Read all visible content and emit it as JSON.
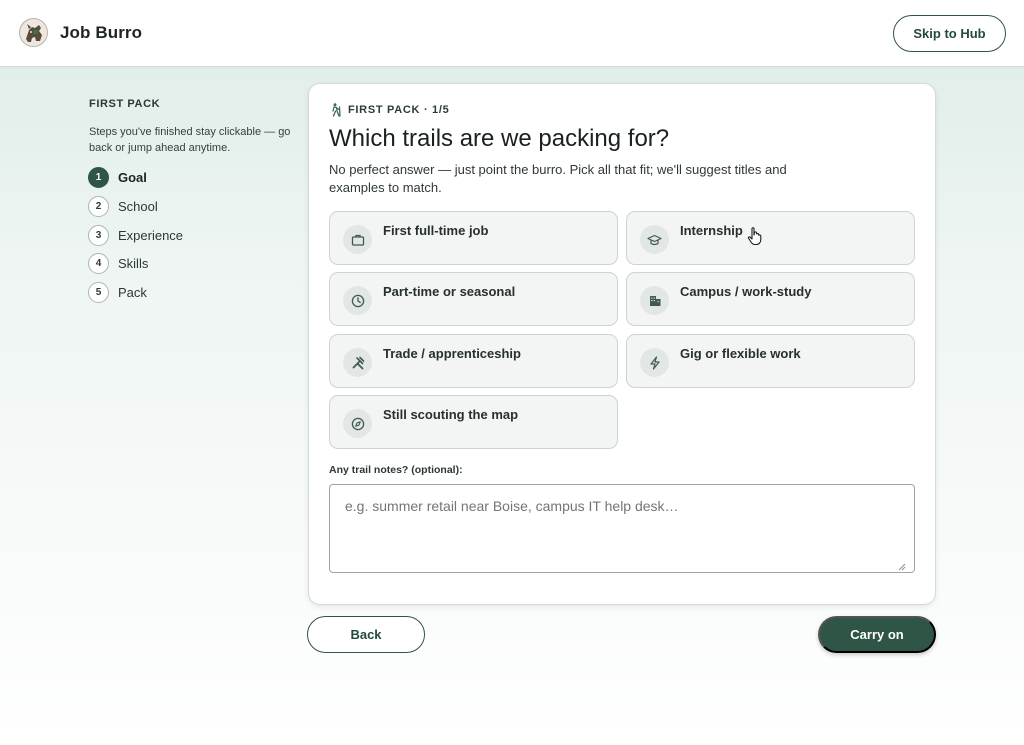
{
  "header": {
    "brand": "Job Burro",
    "skip_label": "Skip to Hub"
  },
  "sidebar": {
    "title": "FIRST PACK",
    "help": "Steps you've finished stay clickable — go back or jump ahead anytime.",
    "steps": [
      {
        "num": "1",
        "label": "Goal",
        "active": true
      },
      {
        "num": "2",
        "label": "School"
      },
      {
        "num": "3",
        "label": "Experience"
      },
      {
        "num": "4",
        "label": "Skills"
      },
      {
        "num": "5",
        "label": "Pack"
      }
    ]
  },
  "card": {
    "eyebrow": "FIRST PACK · 1/5",
    "title": "Which trails are we packing for?",
    "subtitle": "No perfect answer — just point the burro. Pick all that fit; we'll suggest titles and examples to match.",
    "options": [
      {
        "label": "First full-time job",
        "icon": "briefcase-icon"
      },
      {
        "label": "Internship",
        "icon": "graduation-cap-icon"
      },
      {
        "label": "Part-time or seasonal",
        "icon": "clock-icon"
      },
      {
        "label": "Campus / work-study",
        "icon": "building-icon"
      },
      {
        "label": "Trade / apprenticeship",
        "icon": "tools-icon"
      },
      {
        "label": "Gig or flexible work",
        "icon": "lightning-icon"
      },
      {
        "label": "Still scouting the map",
        "icon": "compass-icon"
      }
    ],
    "notes_label": "Any trail notes? (optional):",
    "notes_placeholder": "e.g. summer retail near Boise, campus IT help desk…",
    "notes_value": ""
  },
  "footer": {
    "back_label": "Back",
    "next_label": "Carry on"
  },
  "colors": {
    "accent": "#2f5546",
    "option_bg": "#f3f5f4",
    "page_bg_top": "#dcece7"
  }
}
